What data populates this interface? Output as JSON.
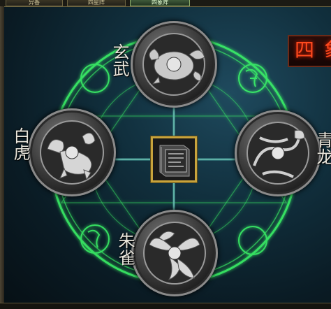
{
  "tabs": [
    {
      "label": "异香",
      "active": false
    },
    {
      "label": "四星阵",
      "active": false
    },
    {
      "label": "四象阵",
      "active": true
    }
  ],
  "title": "四象",
  "guardians": {
    "north": {
      "label": "玄武",
      "icon": "tortoise-icon"
    },
    "west": {
      "label": "白虎",
      "icon": "tiger-icon"
    },
    "east": {
      "label": "青龙",
      "icon": "dragon-icon"
    },
    "south": {
      "label": "朱雀",
      "icon": "phoenix-icon"
    }
  },
  "center_item": {
    "icon": "book-icon"
  },
  "colors": {
    "magic_circle": "#3dff6a",
    "frame_gold": "#c8a33c",
    "title_red": "#ff4a1e"
  }
}
